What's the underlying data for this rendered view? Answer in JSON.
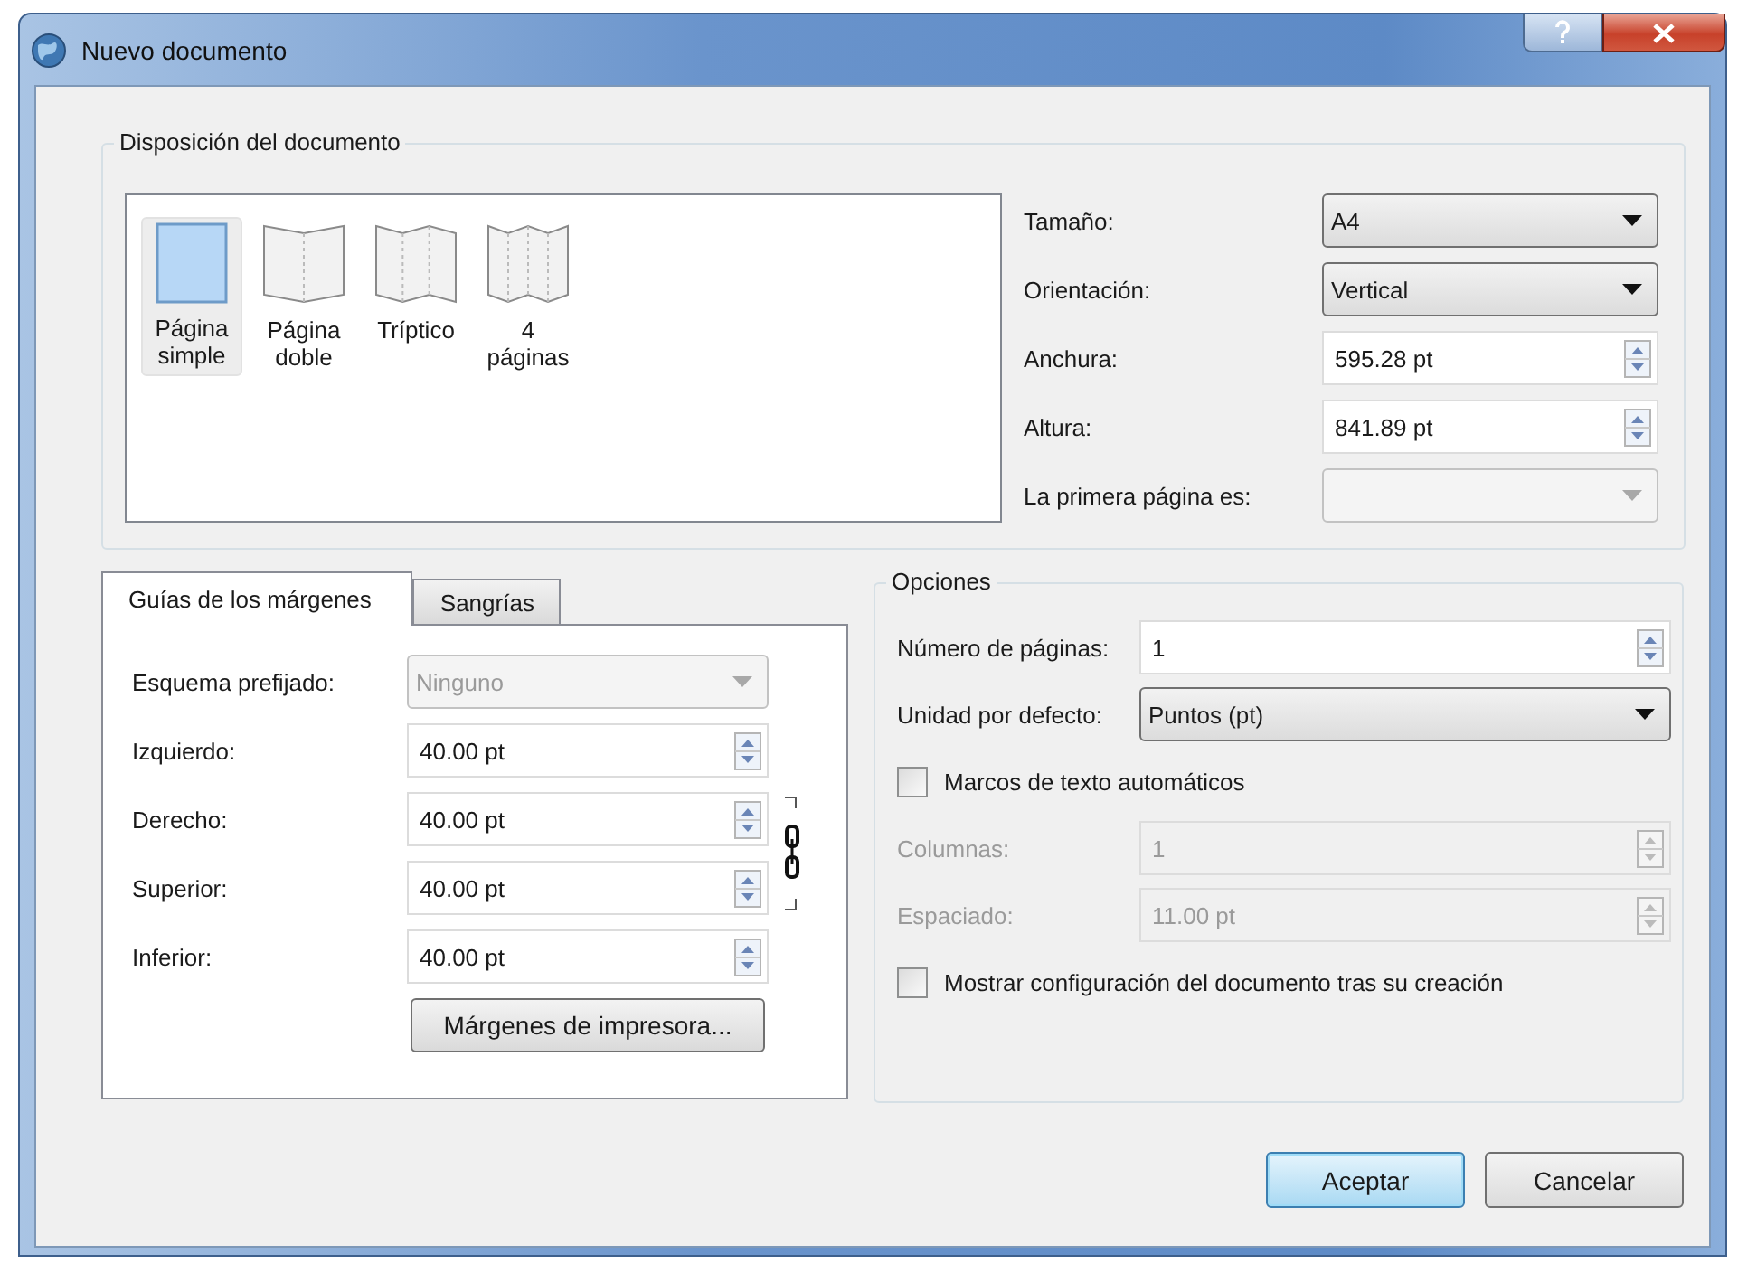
{
  "window": {
    "title": "Nuevo documento"
  },
  "layout": {
    "title": "Disposición del documento",
    "page_types": [
      {
        "label": "Página simple",
        "selected": true
      },
      {
        "label": "Página doble",
        "selected": false
      },
      {
        "label": "Tríptico",
        "selected": false
      },
      {
        "label": "4 páginas",
        "selected": false
      }
    ],
    "fields": [
      {
        "kind": "combo",
        "label": "Tamaño:",
        "value": "A4",
        "disabled": false
      },
      {
        "kind": "combo",
        "label": "Orientación:",
        "value": "Vertical",
        "disabled": false
      },
      {
        "kind": "spin",
        "label": "Anchura:",
        "value": "595.28 pt",
        "disabled": false
      },
      {
        "kind": "spin",
        "label": "Altura:",
        "value": "841.89 pt",
        "disabled": false
      },
      {
        "kind": "combo",
        "label": "La primera página es:",
        "disabled": true
      }
    ]
  },
  "tabs": [
    {
      "label": "Guías de los márgenes",
      "selected": true
    },
    {
      "label": "Sangrías",
      "selected": false
    }
  ],
  "margins": {
    "fields": [
      {
        "kind": "combo",
        "label": "Esquema prefijado:",
        "value": "Ninguno",
        "disabled": true
      },
      {
        "kind": "spin",
        "label": "Izquierdo:",
        "value": "40.00 pt",
        "disabled": false
      },
      {
        "kind": "spin",
        "label": "Derecho:",
        "value": "40.00 pt",
        "disabled": false
      },
      {
        "kind": "spin",
        "label": "Superior:",
        "value": "40.00 pt",
        "disabled": false
      },
      {
        "kind": "spin",
        "label": "Inferior:",
        "value": "40.00 pt",
        "disabled": false
      }
    ],
    "button": "Márgenes de impresora..."
  },
  "options": {
    "title": "Opciones",
    "fields": [
      {
        "kind": "spin",
        "label": "Número de páginas:",
        "value": "1",
        "disabled": false
      },
      {
        "kind": "combo",
        "label": "Unidad por defecto:",
        "value": "Puntos (pt)",
        "disabled": false
      },
      {
        "kind": "checkbox",
        "label": "Marcos de texto automáticos",
        "checked": false,
        "disabled": false
      },
      {
        "kind": "spin",
        "label": "Columnas:",
        "value": "1",
        "disabled": true
      },
      {
        "kind": "spin",
        "label": "Espaciado:",
        "value": "11.00 pt",
        "disabled": true
      },
      {
        "kind": "checkbox",
        "label": "Mostrar configuración del documento tras su creación",
        "checked": false,
        "disabled": false
      }
    ]
  },
  "buttons": [
    {
      "label": "Aceptar",
      "default": true
    },
    {
      "label": "Cancelar",
      "default": false
    }
  ]
}
